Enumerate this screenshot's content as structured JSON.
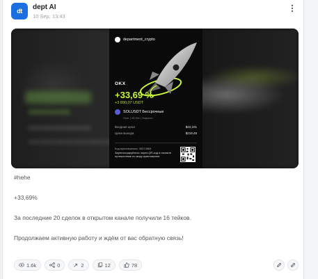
{
  "channel": {
    "avatar_text": "dt",
    "name": "dept AI",
    "time": "10 Sep, 13:43"
  },
  "poster": {
    "handle": "department_crypto",
    "exchange": "OKX",
    "percent": "+33,69 %",
    "usdt": "+3 890,07 USDT",
    "pair": "SOLUSDT Бессрочные",
    "pair_sub": "Лонг | 40.00x | Закрыто",
    "entry_label": "Входная цена",
    "entry_value": "$22,101",
    "exit_label": "Цена выхода",
    "exit_value": "$219,49",
    "ref_code": "Код приглашения: 30074884",
    "ref_text": "Зарегистрируйтесь через QR-код и начните путешествие по миру криптовалют",
    "accent": "#c8f53c"
  },
  "post": {
    "line1": "#hehe",
    "line2": "+33,69%",
    "line3": "За последние 20 сделок в открытом канале получили 16 тейков.",
    "line4": "Продолжаем активную работу и ждём от вас обратную связь!"
  },
  "stats": {
    "views": "1.6k",
    "comments": "0",
    "reposts": "2",
    "saves": "12",
    "likes": "78"
  }
}
